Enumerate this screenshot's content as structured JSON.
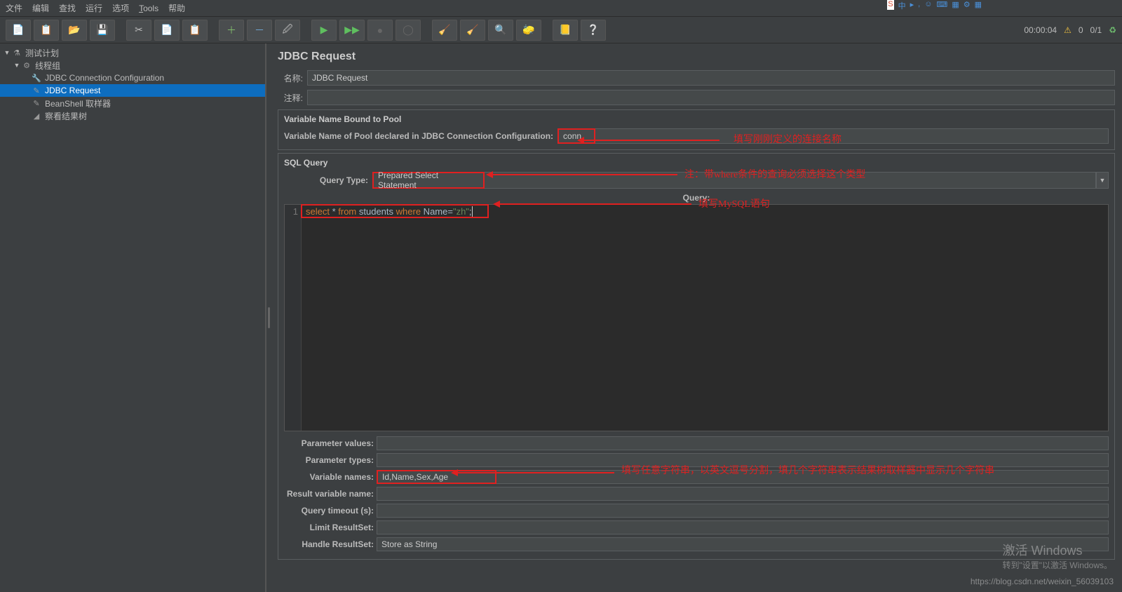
{
  "menubar": {
    "file": "文件",
    "edit": "编辑",
    "find": "查找",
    "run": "运行",
    "options": "选项",
    "tools": "Tools",
    "help": "帮助"
  },
  "toolbar_right": {
    "elapsed": "00:00:04",
    "warn_count": "0",
    "ratio": "0/1"
  },
  "tree": {
    "testplan": "测试计划",
    "threadgroup": "线程组",
    "jdbc_conn": "JDBC Connection Configuration",
    "jdbc_req": "JDBC Request",
    "beanshell": "BeanShell 取样器",
    "results": "察看结果树"
  },
  "content": {
    "heading": "JDBC Request",
    "name_label": "名称:",
    "name_value": "JDBC Request",
    "comment_label": "注释:",
    "comment_value": "",
    "pool_section_title": "Variable Name Bound to Pool",
    "pool_label": "Variable Name of Pool declared in JDBC Connection Configuration:",
    "pool_value": "conn",
    "sql_section_title": "SQL Query",
    "query_type_label": "Query Type:",
    "query_type_value": "Prepared Select Statement",
    "query_label": "Query:",
    "sql_line_no": "1",
    "sql_kw_select": "select",
    "sql_star": " * ",
    "sql_kw_from": "from",
    "sql_table": " students ",
    "sql_kw_where": "where",
    "sql_col": " Name=",
    "sql_str": "\"zh\"",
    "sql_end": ";",
    "fields": {
      "param_values": {
        "label": "Parameter values:",
        "value": ""
      },
      "param_types": {
        "label": "Parameter types:",
        "value": ""
      },
      "var_names": {
        "label": "Variable names:",
        "value": "Id,Name,Sex,Age"
      },
      "result_var": {
        "label": "Result variable name:",
        "value": ""
      },
      "timeout": {
        "label": "Query timeout (s):",
        "value": ""
      },
      "limit": {
        "label": "Limit ResultSet:",
        "value": ""
      },
      "handle": {
        "label": "Handle ResultSet:",
        "value": "Store as String"
      }
    }
  },
  "annotations": {
    "a1": "填写刚刚定义的连接名称",
    "a2": "注：带where条件的查询必须选择这个类型",
    "a3": "填写MySQL语句",
    "a4": "填写任意字符串，以英文逗号分割，填几个字符串表示结果树取样器中显示几个字符串"
  },
  "overlay": {
    "activate_title": "激活 Windows",
    "activate_sub": "转到\"设置\"以激活 Windows。",
    "watermark": "https://blog.csdn.net/weixin_56039103",
    "char": "中"
  }
}
